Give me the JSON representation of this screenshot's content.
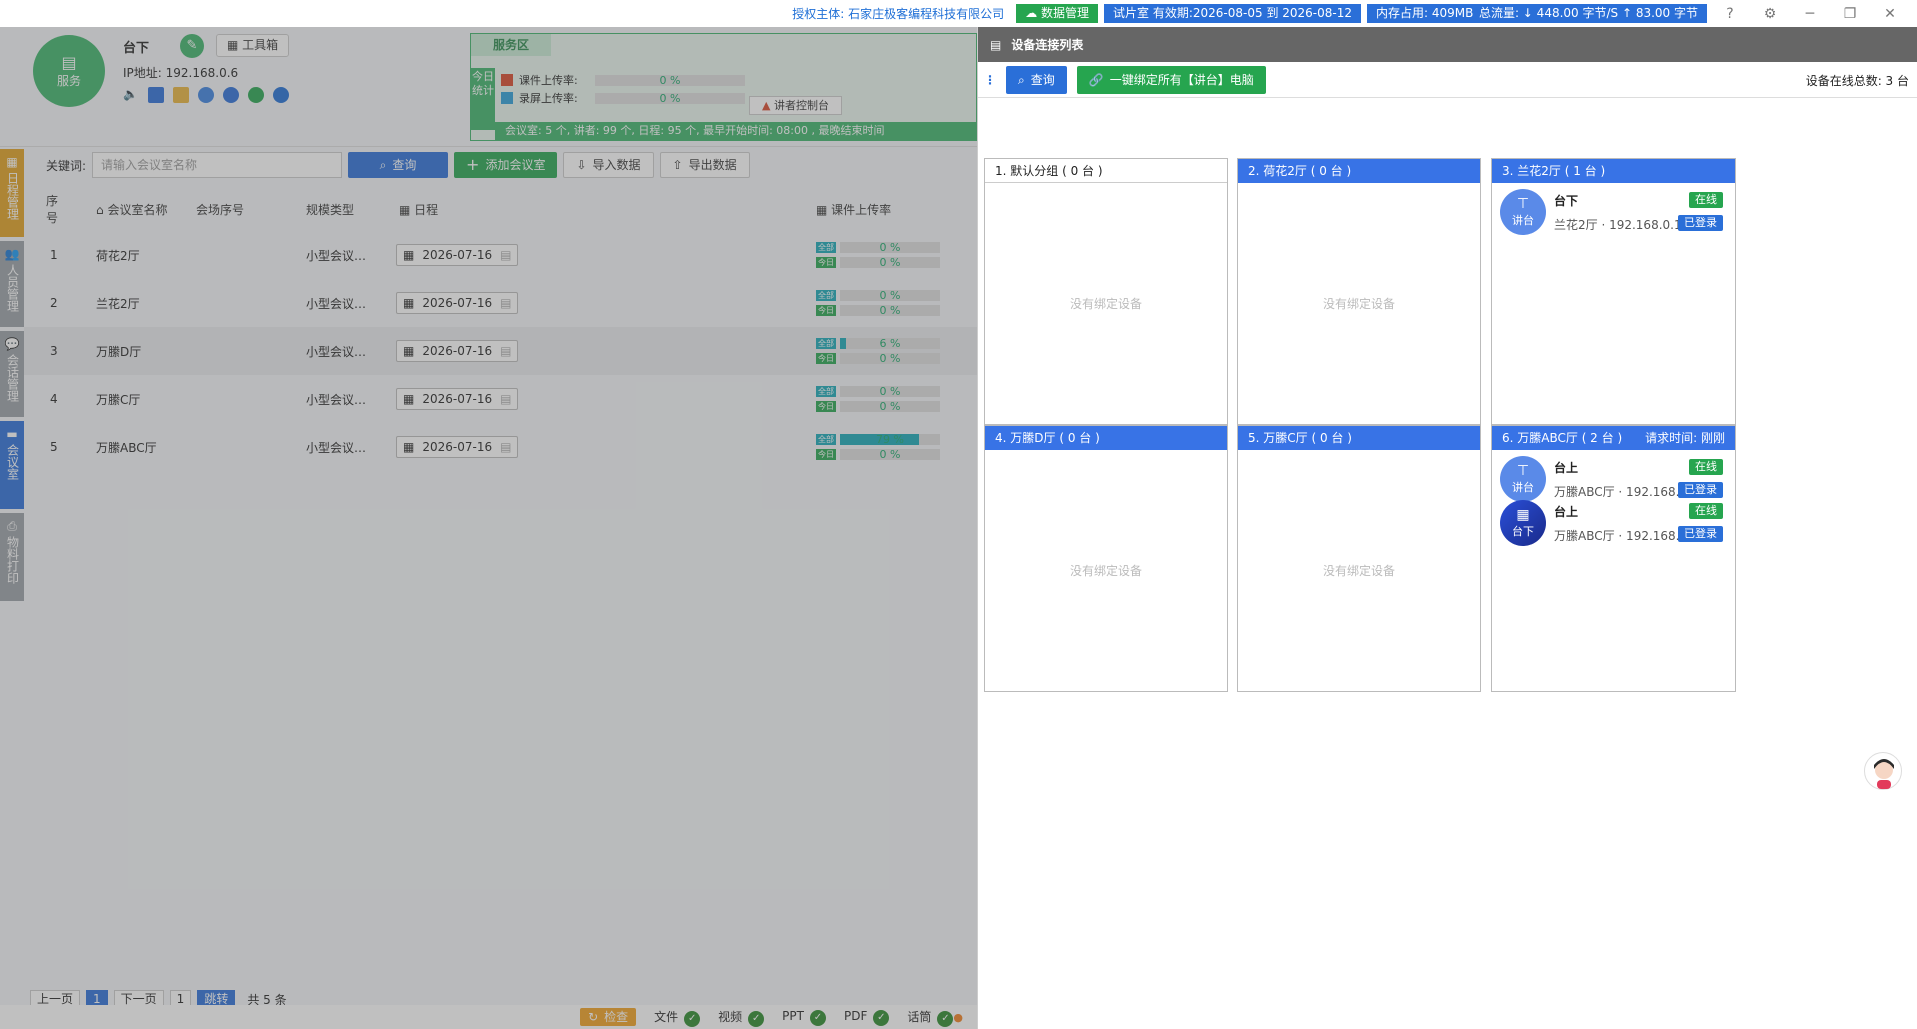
{
  "topbar": {
    "auth_label": "授权主体:",
    "auth_company": "石家庄极客编程科技有限公司",
    "data_mgmt": "数据管理",
    "trial": "试片室 有效期:2026-08-05 到 2026-08-12",
    "memory": "内存占用: 409MB",
    "traffic": "总流量: ↓ 448.00 字节/S  ↑ 83.00 字节",
    "colors": {
      "green": "#26a54f",
      "blue": "#2a6fd8",
      "link": "#1f6fd6"
    }
  },
  "header": {
    "logo_label": "服务",
    "username": "台下",
    "ip": "IP地址: 192.168.0.6",
    "tools_label": "工具箱"
  },
  "service_zone": {
    "title": "服务区",
    "stat_label": "今日统计",
    "rows": [
      {
        "label": "课件上传率:",
        "value": "0 %"
      },
      {
        "label": "录屏上传率:",
        "value": "0 %"
      }
    ],
    "console_label": "讲者控制台",
    "summary": "会议室: 5 个,  讲者: 99 个,  日程: 95 个,  最早开始时间: 08:00 ,  最晚结束时间"
  },
  "sidenav": [
    {
      "label": "日程管理",
      "color": "#e0a020"
    },
    {
      "label": "人员管理",
      "color": "#9aa0a6"
    },
    {
      "label": "会话管理",
      "color": "#9aa0a6"
    },
    {
      "label": "会议室",
      "color": "#2a6fd8"
    },
    {
      "label": "物料打印",
      "color": "#9aa0a6"
    }
  ],
  "toolbar": {
    "keyword_label": "关键词:",
    "search_placeholder": "请输入会议室名称",
    "query_label": "查询",
    "add_label": "添加会议室",
    "import_label": "导入数据",
    "export_label": "导出数据"
  },
  "table": {
    "headers": [
      "序号",
      "会议室名称",
      "会场序号",
      "规模类型",
      "日程",
      "课件上传率"
    ],
    "tag_all": "全部",
    "tag_today": "今日",
    "rows": [
      {
        "no": "1",
        "name": "荷花2厅",
        "seq": "",
        "type": "小型会议…",
        "date": "2026-07-16",
        "all": "0 %",
        "all_fill": 0,
        "today": "0 %"
      },
      {
        "no": "2",
        "name": "兰花2厅",
        "seq": "",
        "type": "小型会议…",
        "date": "2026-07-16",
        "all": "0 %",
        "all_fill": 0,
        "today": "0 %"
      },
      {
        "no": "3",
        "name": "万縢D厅",
        "seq": "",
        "type": "小型会议…",
        "date": "2026-07-16",
        "all": "6 %",
        "all_fill": 0.06,
        "today": "0 %"
      },
      {
        "no": "4",
        "name": "万縢C厅",
        "seq": "",
        "type": "小型会议…",
        "date": "2026-07-16",
        "all": "0 %",
        "all_fill": 0,
        "today": "0 %"
      },
      {
        "no": "5",
        "name": "万縢ABC厅",
        "seq": "",
        "type": "小型会议…",
        "date": "2026-07-16",
        "all": "79 %",
        "all_fill": 0.79,
        "today": "0 %"
      }
    ]
  },
  "pager": {
    "prev": "上一页",
    "current": "1",
    "next": "下一页",
    "input": "1",
    "jump": "跳转",
    "total": "共 5 条"
  },
  "footer": {
    "check": "检查",
    "items": [
      "文件",
      "视频",
      "PPT",
      "PDF",
      "话筒"
    ]
  },
  "panel": {
    "title": "设备连接列表",
    "query_label": "查询",
    "bind_label": "一键绑定所有【讲台】电脑",
    "online_total": "设备在线总数: 3 台",
    "empty_text": "没有绑定设备",
    "groups": [
      {
        "title": "1. 默认分组 ( 0 台 )",
        "devices": []
      },
      {
        "title": "2. 荷花2厅 ( 0 台 )",
        "devices": []
      },
      {
        "title": "3. 兰花2厅 ( 1 台 )",
        "devices": [
          {
            "avatar": "讲台",
            "name": "台下",
            "detail": "兰花2厅 · 192.168.0.17",
            "status": "在线",
            "login": "已登录"
          }
        ]
      },
      {
        "title": "4. 万縢D厅 ( 0 台 )",
        "devices": []
      },
      {
        "title": "5. 万縢C厅 ( 0 台 )",
        "devices": []
      },
      {
        "title": "6. 万縢ABC厅 ( 2 台 )",
        "request": "请求时间: 刚刚",
        "devices": [
          {
            "avatar": "讲台",
            "name": "台上",
            "detail": "万縢ABC厅 · 192.168.0.5",
            "status": "在线",
            "login": "已登录"
          },
          {
            "avatar": "台下",
            "name": "台上",
            "detail": "万縢ABC厅 · 192.168.0.2",
            "status": "在线",
            "login": "已登录"
          }
        ]
      }
    ]
  }
}
